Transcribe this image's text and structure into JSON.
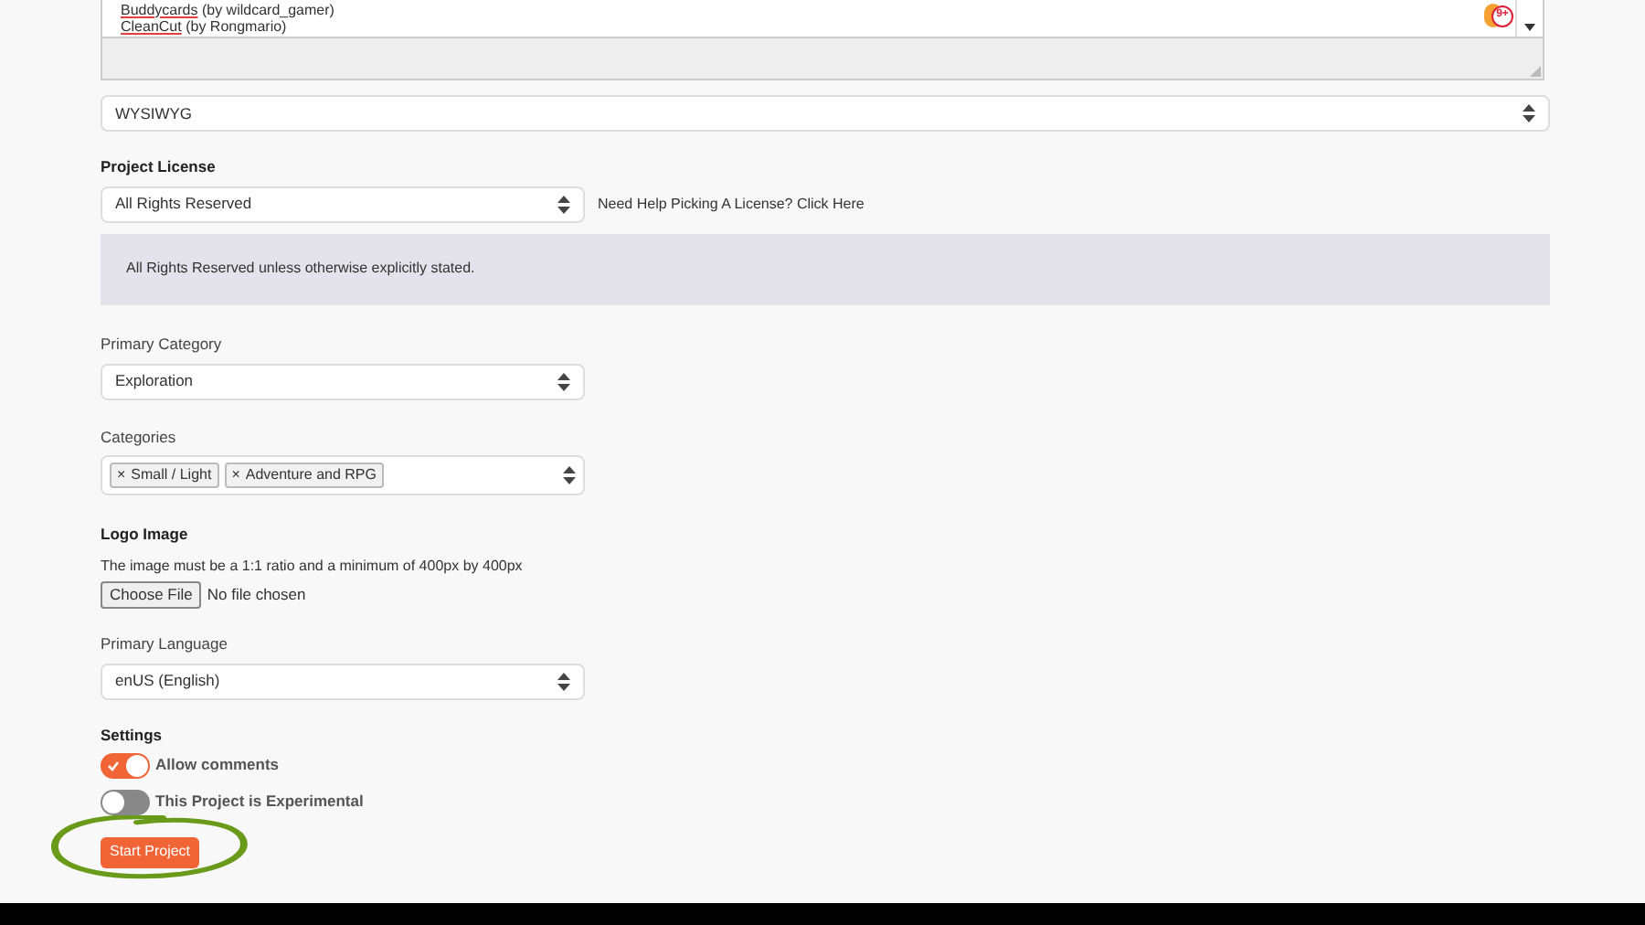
{
  "mentions": {
    "lines": [
      {
        "name": "Buddycards",
        "author": "(by wildcard_gamer)"
      },
      {
        "name": "CleanCut",
        "author": "(by Rongmario)"
      }
    ],
    "badge": "9+"
  },
  "editor_mode": {
    "value": "WYSIWYG"
  },
  "license": {
    "label": "Project License",
    "value": "All Rights Reserved",
    "help_link": "Need Help Picking A License? Click Here",
    "notice": "All Rights Reserved unless otherwise explicitly stated."
  },
  "primary_category": {
    "label": "Primary Category",
    "value": "Exploration"
  },
  "categories": {
    "label": "Categories",
    "tags": [
      {
        "remove": "×",
        "text": "Small / Light"
      },
      {
        "remove": "×",
        "text": "Adventure and RPG"
      }
    ]
  },
  "logo": {
    "label": "Logo Image",
    "hint": "The image must be a 1:1 ratio and a minimum of 400px by 400px",
    "button": "Choose File",
    "status": "No file chosen"
  },
  "language": {
    "label": "Primary Language",
    "value": "enUS (English)"
  },
  "settings": {
    "label": "Settings",
    "toggles": [
      {
        "label": "Allow comments",
        "on": true
      },
      {
        "label": "This Project is Experimental",
        "on": false
      }
    ]
  },
  "submit": "Start Project"
}
